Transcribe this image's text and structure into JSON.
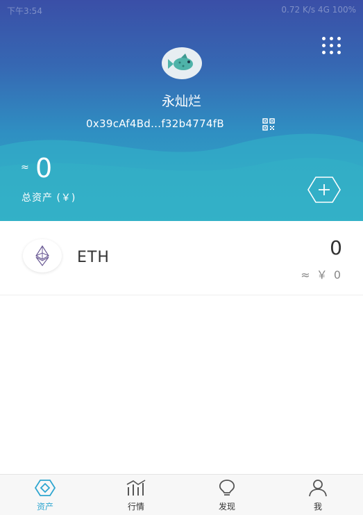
{
  "status_bar": {
    "left": "下午3:54",
    "right": "0.72 K/s 4G 100%"
  },
  "header": {
    "user_name": "永灿烂",
    "address": "0x39cAf4Bd...f32b4774fB",
    "approx_symbol": "≈",
    "total_balance": "0",
    "total_label": "总资产 (￥)"
  },
  "assets": [
    {
      "symbol": "ETH",
      "amount": "0",
      "value": "≈ ￥ 0"
    }
  ],
  "tabbar": {
    "tabs": [
      {
        "label": "资产",
        "icon": "wallet-icon",
        "active": true
      },
      {
        "label": "行情",
        "icon": "chart-icon",
        "active": false
      },
      {
        "label": "发现",
        "icon": "lightbulb-icon",
        "active": false
      },
      {
        "label": "我",
        "icon": "user-icon",
        "active": false
      }
    ]
  },
  "colors": {
    "accent": "#2fa6d0",
    "header_top": "#3a4fa7",
    "header_bottom": "#33aec6"
  }
}
